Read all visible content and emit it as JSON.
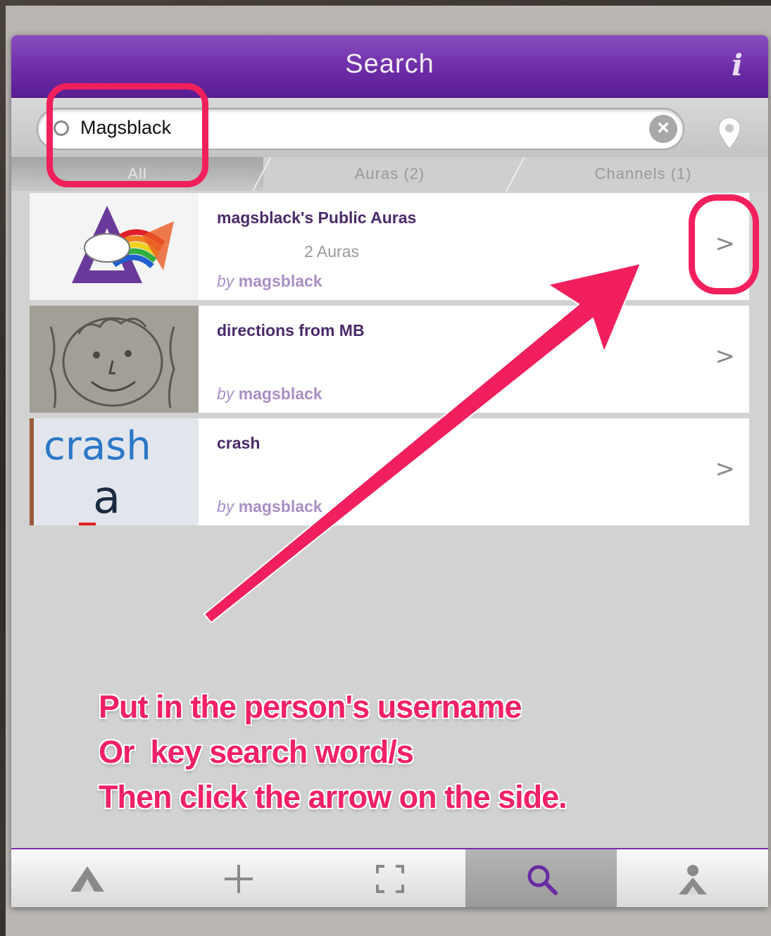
{
  "header": {
    "title": "Search",
    "info_label": "i"
  },
  "search": {
    "value": "Magsblack",
    "clear_label": "×"
  },
  "tabs": [
    {
      "label": "All"
    },
    {
      "label": "Auras (2)"
    },
    {
      "label": "Channels (1)"
    }
  ],
  "results": [
    {
      "title": "magsblack's Public Auras",
      "subtitle": "2 Auras",
      "by_prefix": "by",
      "by_user": "magsblack"
    },
    {
      "title": "directions from MB",
      "subtitle": "",
      "by_prefix": "by",
      "by_user": "magsblack"
    },
    {
      "title": "crash",
      "subtitle": "",
      "by_prefix": "by",
      "by_user": "magsblack"
    }
  ],
  "thumb_text": {
    "crash_word": "crash",
    "crash_letter": "a"
  },
  "bottom_nav": [
    {
      "icon": "aura-triangle-icon"
    },
    {
      "icon": "plus-icon"
    },
    {
      "icon": "scan-frame-icon"
    },
    {
      "icon": "search-icon",
      "active": true
    },
    {
      "icon": "profile-icon"
    }
  ],
  "annotation": {
    "line1": "Put in the person's username",
    "line2": "Or  key search word/s",
    "line3": "Then click the arrow on the side."
  },
  "colors": {
    "accent": "#6a2aa4",
    "annotation": "#f1205c"
  }
}
